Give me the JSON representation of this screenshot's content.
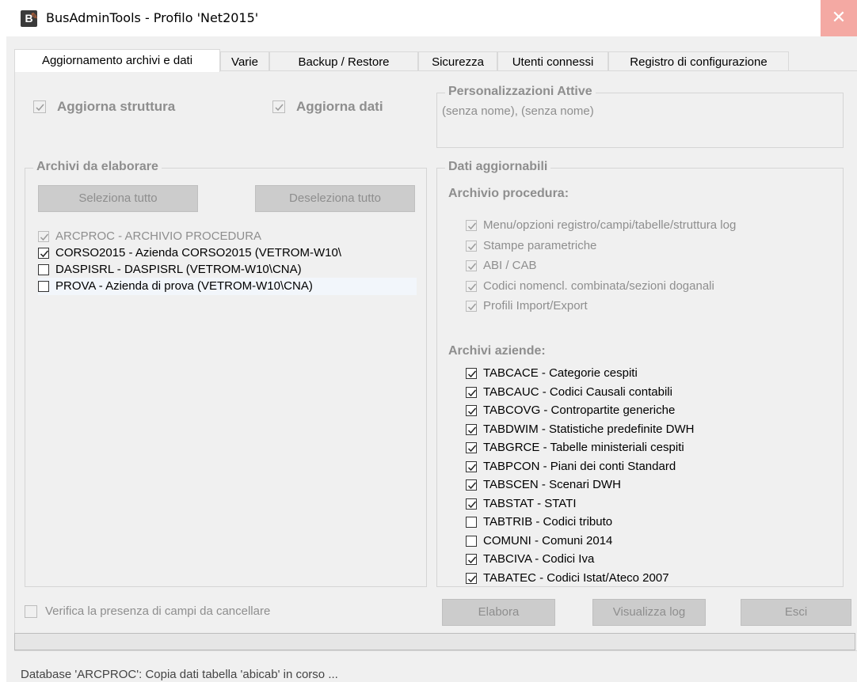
{
  "window": {
    "title": "BusAdminTools - Profilo 'Net2015'",
    "icon_letter": "B"
  },
  "tabs": [
    {
      "label": "Aggiornamento archivi e dati",
      "active": true
    },
    {
      "label": "Varie"
    },
    {
      "label": "Backup / Restore"
    },
    {
      "label": "Sicurezza"
    },
    {
      "label": "Utenti connessi"
    },
    {
      "label": "Registro di configurazione"
    }
  ],
  "options": {
    "update_structure": {
      "label": "Aggiorna struttura",
      "checked": true
    },
    "update_data": {
      "label": "Aggiorna dati",
      "checked": true
    }
  },
  "customizations": {
    "title": "Personalizzazioni Attive",
    "text": "(senza nome), (senza nome)"
  },
  "archives": {
    "title": "Archivi da elaborare",
    "select_all": "Seleziona tutto",
    "deselect_all": "Deseleziona tutto",
    "items": [
      {
        "label": "ARCPROC - ARCHIVIO PROCEDURA",
        "checked": true,
        "disabled": true
      },
      {
        "label": "CORSO2015 - Azienda CORSO2015 (VETROM-W10\\",
        "checked": true
      },
      {
        "label": "DASPISRL - DASPISRL (VETROM-W10\\CNA)",
        "checked": false
      },
      {
        "label": "PROVA - Azienda di prova (VETROM-W10\\CNA)",
        "checked": false
      }
    ]
  },
  "updatable": {
    "title": "Dati aggiornabili",
    "procedure_title": "Archivio procedura:",
    "procedure_items": [
      "Menu/opzioni registro/campi/tabelle/struttura log",
      "Stampe parametriche",
      "ABI / CAB",
      "Codici nomencl. combinata/sezioni doganali",
      "Profili Import/Export"
    ],
    "company_title": "Archivi aziende:",
    "company_items": [
      {
        "label": "TABCACE - Categorie cespiti",
        "checked": true
      },
      {
        "label": "TABCAUC - Codici Causali contabili",
        "checked": true
      },
      {
        "label": "TABCOVG - Contropartite generiche",
        "checked": true
      },
      {
        "label": "TABDWIM - Statistiche predefinite DWH",
        "checked": true
      },
      {
        "label": "TABGRCE - Tabelle ministeriali cespiti",
        "checked": true
      },
      {
        "label": "TABPCON - Piani dei conti Standard",
        "checked": true
      },
      {
        "label": "TABSCEN - Scenari DWH",
        "checked": true
      },
      {
        "label": "TABSTAT - STATI",
        "checked": true
      },
      {
        "label": "TABTRIB - Codici tributo",
        "checked": false
      },
      {
        "label": "COMUNI - Comuni 2014",
        "checked": false
      },
      {
        "label": "TABCIVA - Codici Iva",
        "checked": true
      },
      {
        "label": "TABATEC - Codici Istat/Ateco 2007",
        "checked": true
      }
    ]
  },
  "verify": {
    "label": "Verifica la presenza di campi da cancellare",
    "checked": false
  },
  "actions": {
    "process": "Elabora",
    "view_log": "Visualizza log",
    "exit": "Esci"
  },
  "status_text": "Database 'ARCPROC': Copia dati tabella 'abicab' in corso ..."
}
